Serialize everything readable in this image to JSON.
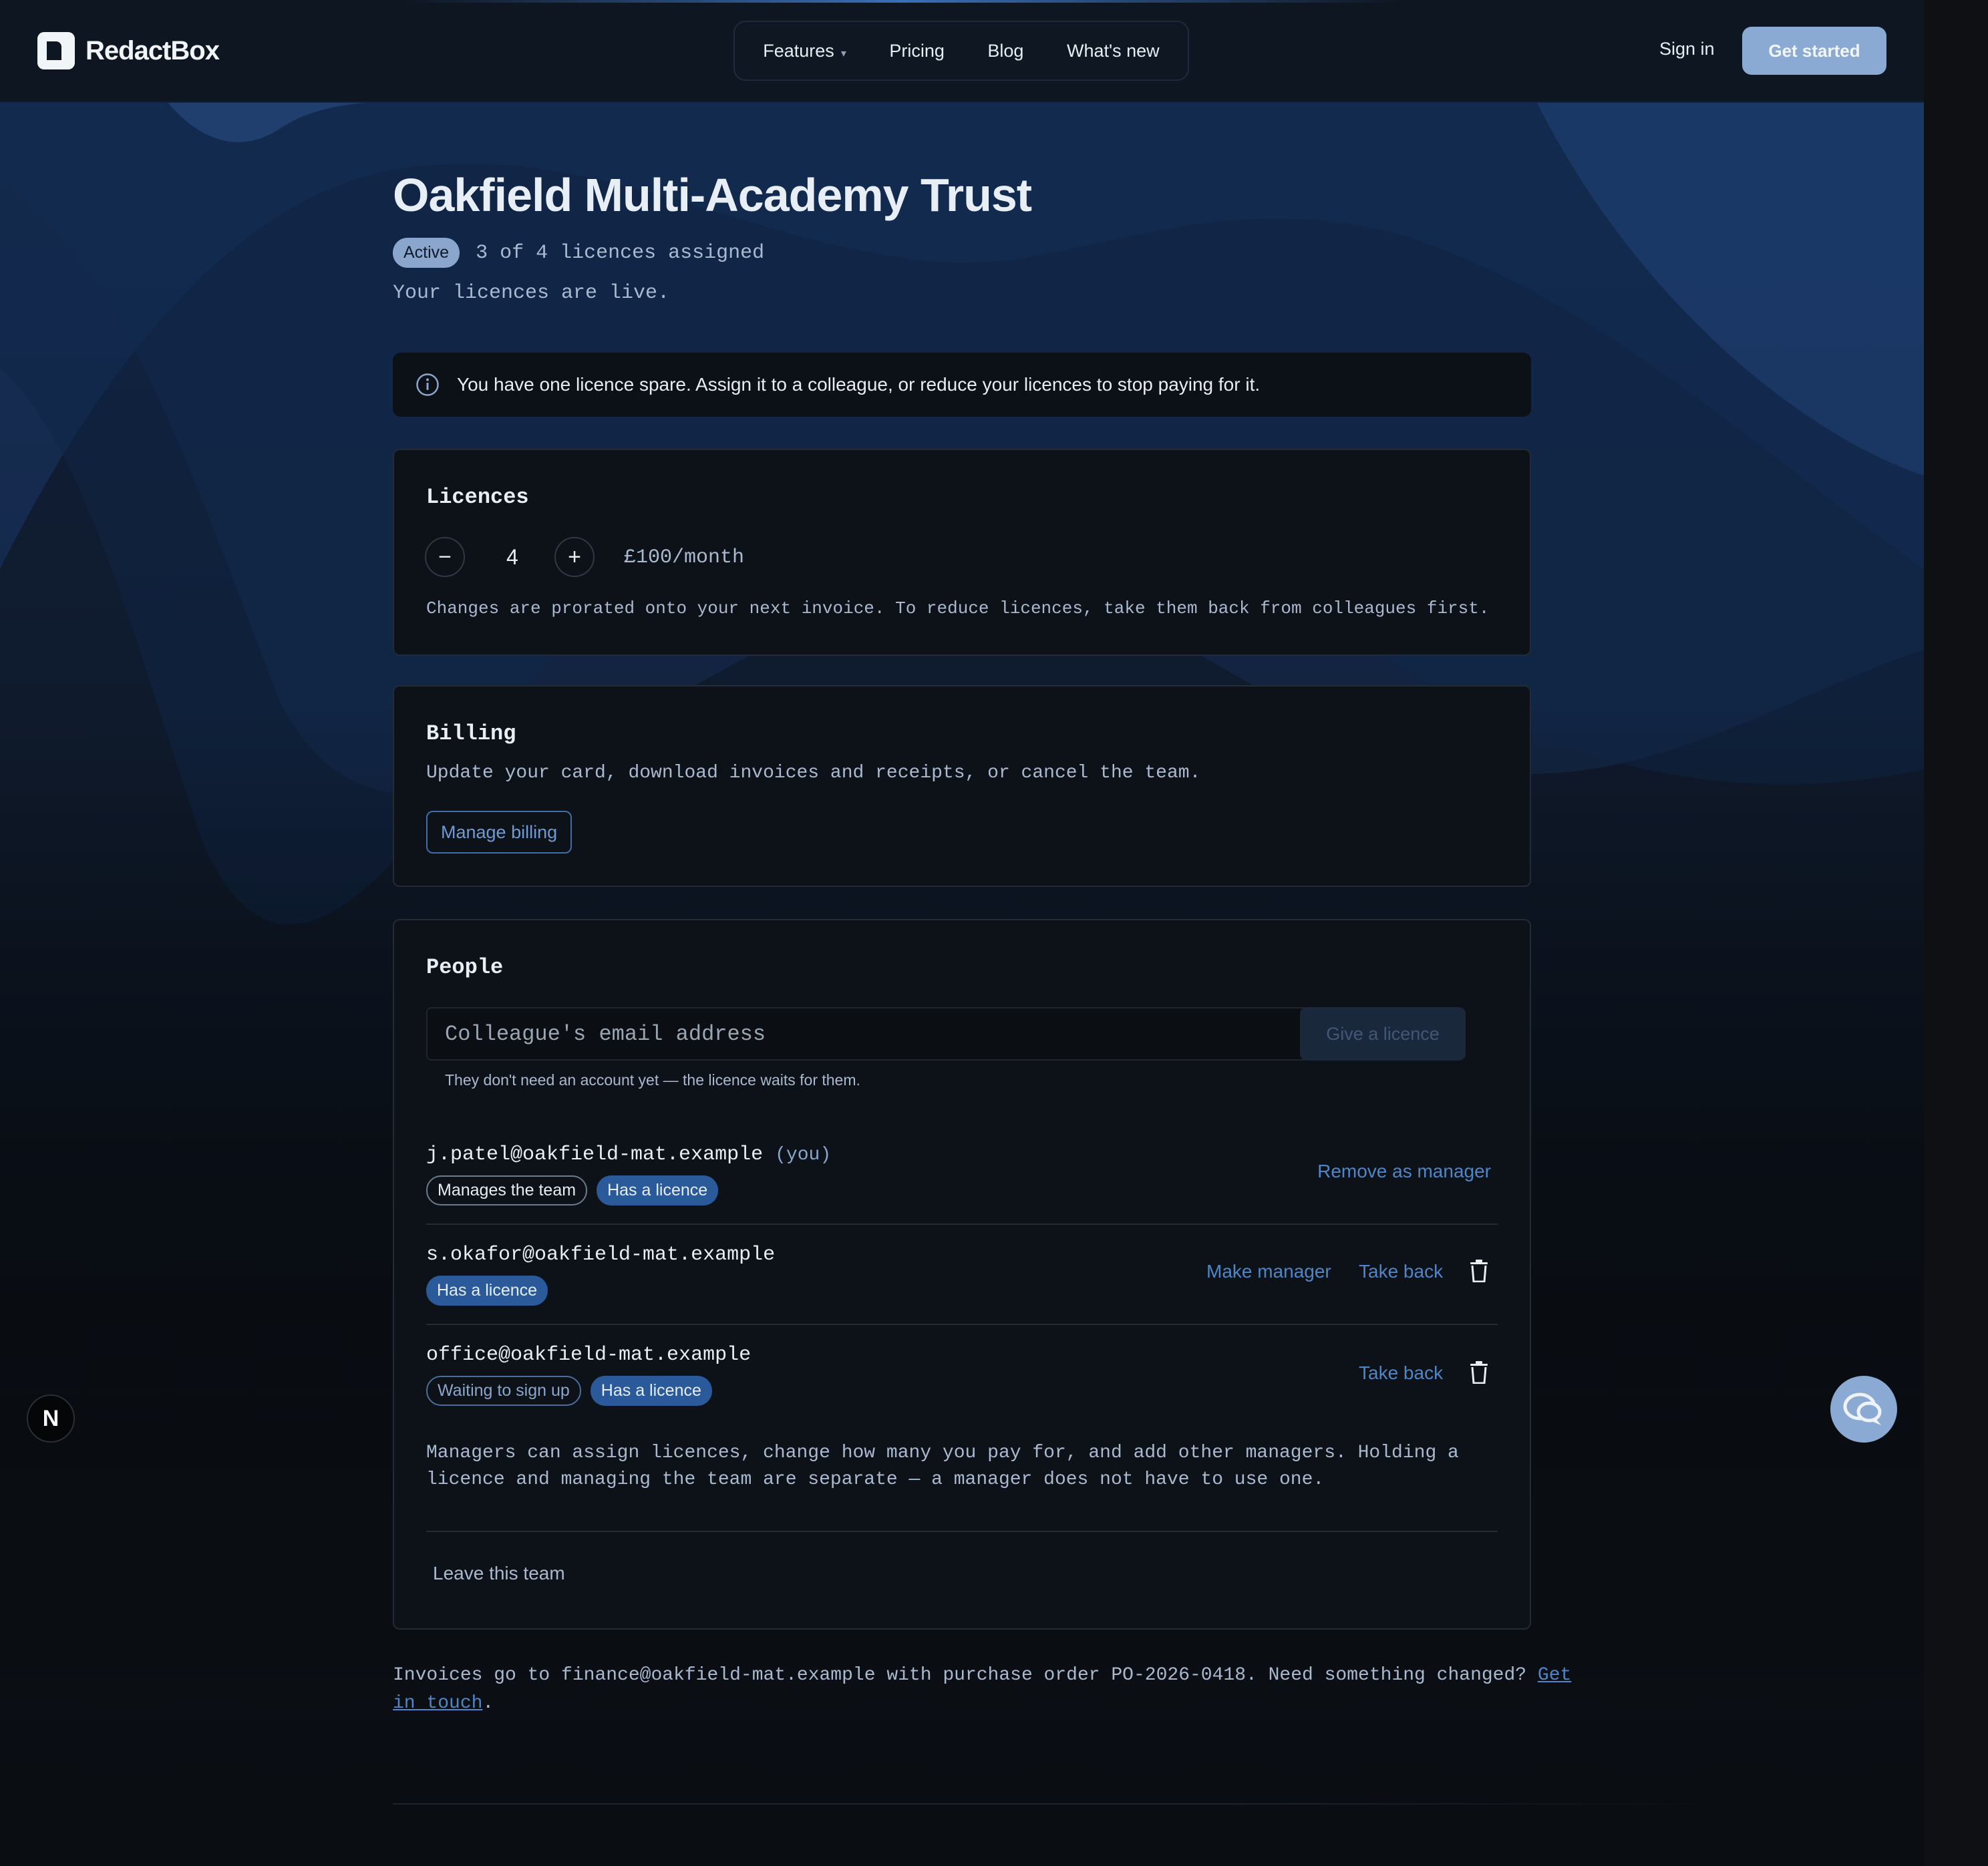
{
  "nav": {
    "brand": "RedactBox",
    "links": [
      {
        "label": "Features",
        "caret": "▾"
      },
      {
        "label": "Pricing"
      },
      {
        "label": "Blog"
      },
      {
        "label": "What's new"
      }
    ],
    "sign_in": "Sign in",
    "get_started": "Get started"
  },
  "header": {
    "title": "Oakfield Multi-Academy Trust",
    "status": "Active",
    "licences_assigned": "3 of 4 licences assigned",
    "subtitle": "Your licences are live."
  },
  "banner": {
    "icon": "info-icon",
    "text": "You have one licence spare. Assign it to a colleague, or reduce your licences to stop paying for it."
  },
  "licences": {
    "title": "Licences",
    "decrement": "−",
    "increment": "+",
    "count": "4",
    "price": "£100/month",
    "note": "Changes are prorated onto your next invoice. To reduce licences, take them back from colleagues first."
  },
  "billing": {
    "title": "Billing",
    "description": "Update your card, download invoices and receipts, or cancel the team.",
    "manage_button": "Manage billing"
  },
  "people": {
    "title": "People",
    "email_placeholder": "Colleague's email address",
    "give_button": "Give a licence",
    "helper": "They don't need an account yet — the licence waits for them.",
    "members": [
      {
        "email": "j.patel@oakfield-mat.example",
        "you": "(you)",
        "badges": [
          "Manages the team",
          "Has a licence"
        ],
        "actions": [
          "Remove as manager"
        ]
      },
      {
        "email": "s.okafor@oakfield-mat.example",
        "badges": [
          "Has a licence"
        ],
        "actions": [
          "Make manager",
          "Take back"
        ]
      },
      {
        "email": "office@oakfield-mat.example",
        "badges": [
          "Waiting to sign up",
          "Has a licence"
        ],
        "actions": [
          "Take back"
        ]
      }
    ],
    "explanation": "Managers can assign licences, change how many you pay for, and add other managers. Holding a licence and managing the team are separate — a manager does not have to use one.",
    "leave": "Leave this team"
  },
  "footer": {
    "text": "Invoices go to finance@oakfield-mat.example with purchase order PO-2026-0418. Need something changed?",
    "link": "Get in touch",
    "end": "."
  },
  "widgets": {
    "n_badge": "N",
    "chat_icon": "chat-icon"
  },
  "colors": {
    "accent": "#8aaad3",
    "link": "#4e86c8",
    "badge_fill": "#2a5a9a",
    "background": "#0d1117"
  }
}
